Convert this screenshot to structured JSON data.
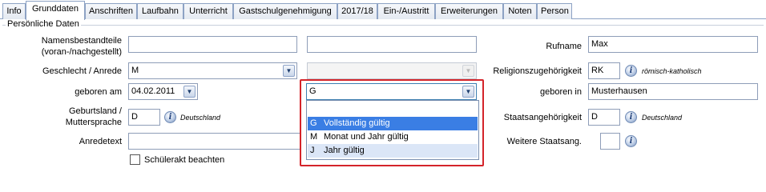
{
  "tabs": [
    {
      "label": "Info",
      "active": false
    },
    {
      "label": "Grunddaten",
      "active": true
    },
    {
      "label": "Anschriften",
      "active": false
    },
    {
      "label": "Laufbahn",
      "active": false
    },
    {
      "label": "Unterricht",
      "active": false
    },
    {
      "label": "Gastschulgenehmigung",
      "active": false
    },
    {
      "label": "2017/18",
      "active": false
    },
    {
      "label": "Ein-/Austritt",
      "active": false
    },
    {
      "label": "Erweiterungen",
      "active": false
    },
    {
      "label": "Noten",
      "active": false
    },
    {
      "label": "Person",
      "active": false
    }
  ],
  "group_title": "Persönliche Daten",
  "form": {
    "namensbestandteile_label_1": "Namensbestandteile",
    "namensbestandteile_label_2": "(voran-/nachgestellt)",
    "namensbestandteil_vor": "",
    "namensbestandteil_nach": "",
    "rufname_label": "Rufname",
    "rufname_value": "Max",
    "geschlecht_label": "Geschlecht / Anrede",
    "geschlecht_value": "M",
    "anrede_value": "",
    "religion_label": "Religionszugehörigkeit",
    "religion_code": "RK",
    "religion_text": "römisch-katholisch",
    "geboren_am_label": "geboren am",
    "geboren_am_value": "04.02.2011",
    "geboren_in_label": "geboren in",
    "geboren_in_value": "Musterhausen",
    "geburtsland_label_1": "Geburtsland /",
    "geburtsland_label_2": "Muttersprache",
    "geburtsland_code": "D",
    "geburtsland_text": "Deutschland",
    "staatsang_label": "Staatsangehörigkeit",
    "staatsang_code": "D",
    "staatsang_text": "Deutschland",
    "anredetext_label": "Anredetext",
    "anredetext_value": "",
    "weitere_staatsang_label": "Weitere Staatsang.",
    "weitere_staatsang_value": "",
    "schuelerakt_label": "Schülerakt beachten",
    "schuelerakt_checked": false
  },
  "date_precision_dropdown": {
    "value": "G",
    "options": [
      {
        "code": "",
        "text": ""
      },
      {
        "code": "G",
        "text": "Vollständig gültig",
        "selected": true
      },
      {
        "code": "M",
        "text": "Monat und Jahr gültig"
      },
      {
        "code": "J",
        "text": "Jahr gültig",
        "hovered": true
      }
    ]
  },
  "icons": {
    "info": "info-icon",
    "dropdown": "chevron-down-icon"
  },
  "colors": {
    "highlight_border": "#d4242a",
    "selected_bg": "#3a7ee4",
    "hover_bg": "#dbe6f7",
    "tab_border": "#8da2c4"
  }
}
